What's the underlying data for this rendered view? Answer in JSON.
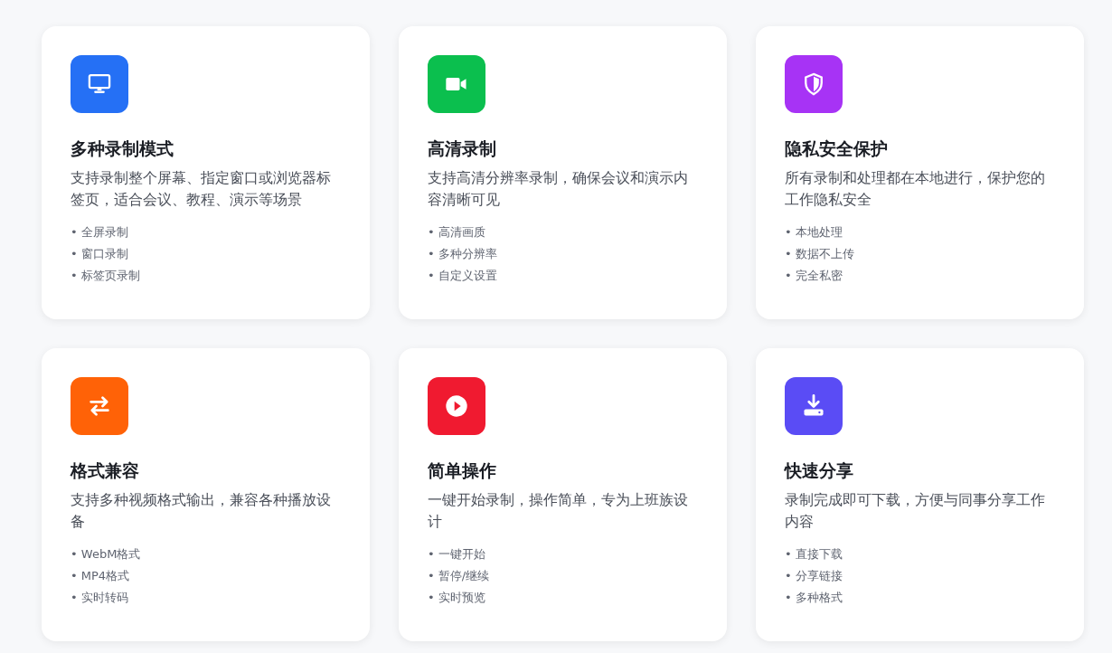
{
  "features": [
    {
      "color": "#2570f5",
      "title": "多种录制模式",
      "description": "支持录制整个屏幕、指定窗口或浏览器标签页，适合会议、教程、演示等场景",
      "points": [
        "• 全屏录制",
        "• 窗口录制",
        "• 标签页录制"
      ]
    },
    {
      "color": "#0bbf4e",
      "title": "高清录制",
      "description": "支持高清分辨率录制，确保会议和演示内容清晰可见",
      "points": [
        "• 高清画质",
        "• 多种分辨率",
        "• 自定义设置"
      ]
    },
    {
      "color": "#a733f5",
      "title": "隐私安全保护",
      "description": "所有录制和处理都在本地进行，保护您的工作隐私安全",
      "points": [
        "• 本地处理",
        "• 数据不上传",
        "• 完全私密"
      ]
    },
    {
      "color": "#ff6207",
      "title": "格式兼容",
      "description": "支持多种视频格式输出，兼容各种播放设备",
      "points": [
        "• WebM格式",
        "• MP4格式",
        "• 实时转码"
      ]
    },
    {
      "color": "#f01a30",
      "title": "简单操作",
      "description": "一键开始录制，操作简单，专为上班族设计",
      "points": [
        "• 一键开始",
        "• 暂停/继续",
        "• 实时预览"
      ]
    },
    {
      "color": "#5a4cf5",
      "title": "快速分享",
      "description": "录制完成即可下载，方便与同事分享工作内容",
      "points": [
        "• 直接下载",
        "• 分享链接",
        "• 多种格式"
      ]
    }
  ]
}
